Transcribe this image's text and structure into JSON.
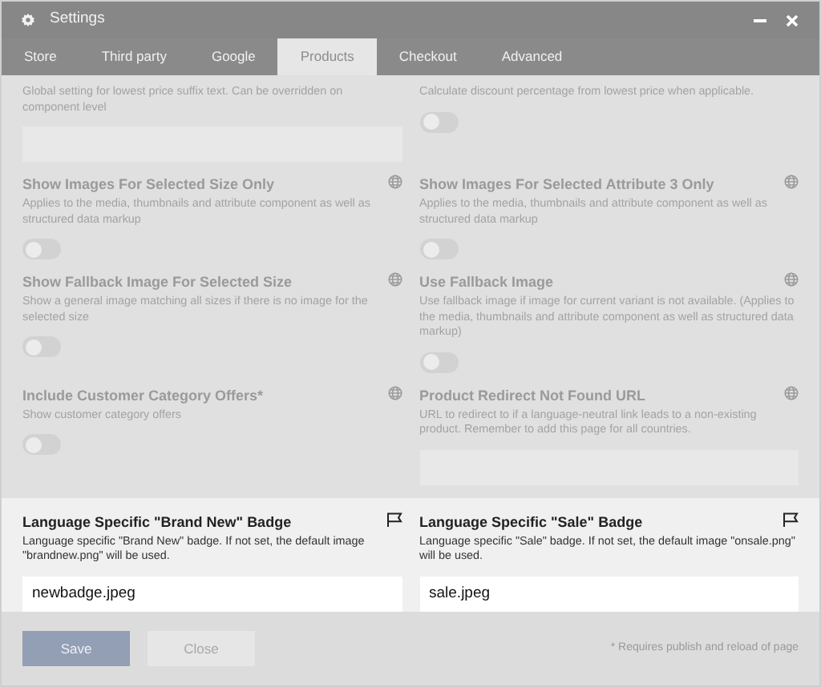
{
  "window": {
    "title": "Settings"
  },
  "tabs": [
    {
      "label": "Store",
      "selected": false
    },
    {
      "label": "Third party",
      "selected": false
    },
    {
      "label": "Google",
      "selected": false
    },
    {
      "label": "Products",
      "selected": true
    },
    {
      "label": "Checkout",
      "selected": false
    },
    {
      "label": "Advanced",
      "selected": false
    }
  ],
  "sections": [
    {
      "focused": false,
      "rows": [
        [
          {
            "description": "Global setting for lowest price suffix text. Can be overridden on component level",
            "kind": "text"
          },
          {
            "description": "Calculate discount percentage from lowest price when applicable.",
            "kind": "toggle",
            "on": false
          }
        ],
        [
          {
            "title": "Show Images For Selected Size Only",
            "scope": {
              "kind": "global"
            },
            "description": "Applies to the media, thumbnails and attribute component as well as structured data markup",
            "kind": "toggle",
            "on": false
          },
          {
            "title": "Show Images For Selected Attribute 3 Only",
            "scope": {
              "kind": "global"
            },
            "description": "Applies to the media, thumbnails and attribute component as well as structured data markup",
            "kind": "toggle",
            "on": false
          }
        ],
        [
          {
            "title": "Show Fallback Image For Selected Size",
            "scope": {
              "kind": "global"
            },
            "description": "Show a general image matching all sizes if there is no image for the selected size",
            "kind": "toggle",
            "on": false
          },
          {
            "title": "Use Fallback Image",
            "scope": {
              "kind": "global"
            },
            "description": "Use fallback image if image for current variant is not available. (Applies to the media, thumbnails and attribute component as well as structured data markup)",
            "kind": "toggle",
            "on": false
          }
        ],
        [
          {
            "title": "Include Customer Category Offers*",
            "scope": {
              "kind": "global"
            },
            "description": "Show customer category offers",
            "kind": "toggle",
            "on": false
          },
          {
            "title": "Product Redirect Not Found URL",
            "scope": {
              "kind": "global"
            },
            "description": "URL to redirect to if a language-neutral link leads to a non-existing product. Remember to add this page for all countries.",
            "kind": "text"
          }
        ]
      ]
    },
    {
      "focused": true,
      "rows": [
        [
          {
            "title": "Language Specific \"Brand New\" Badge",
            "scope": {
              "kind": "language"
            },
            "description": "Language specific \"Brand New\" badge. If not set, the default image \"brandnew.png\" will be used.",
            "kind": "text",
            "value": "newbadge.jpeg"
          },
          {
            "title": "Language Specific \"Sale\" Badge",
            "scope": {
              "kind": "language"
            },
            "description": "Language specific \"Sale\" badge. If not set, the default image \"onsale.png\" will be used.",
            "kind": "text",
            "value": "sale.jpeg"
          }
        ]
      ]
    }
  ],
  "footer": {
    "buttons": [
      {
        "label": "Save",
        "kind": "primary"
      },
      {
        "label": "Close",
        "kind": "secondary"
      }
    ],
    "note": "* Requires publish and reload of page"
  }
}
